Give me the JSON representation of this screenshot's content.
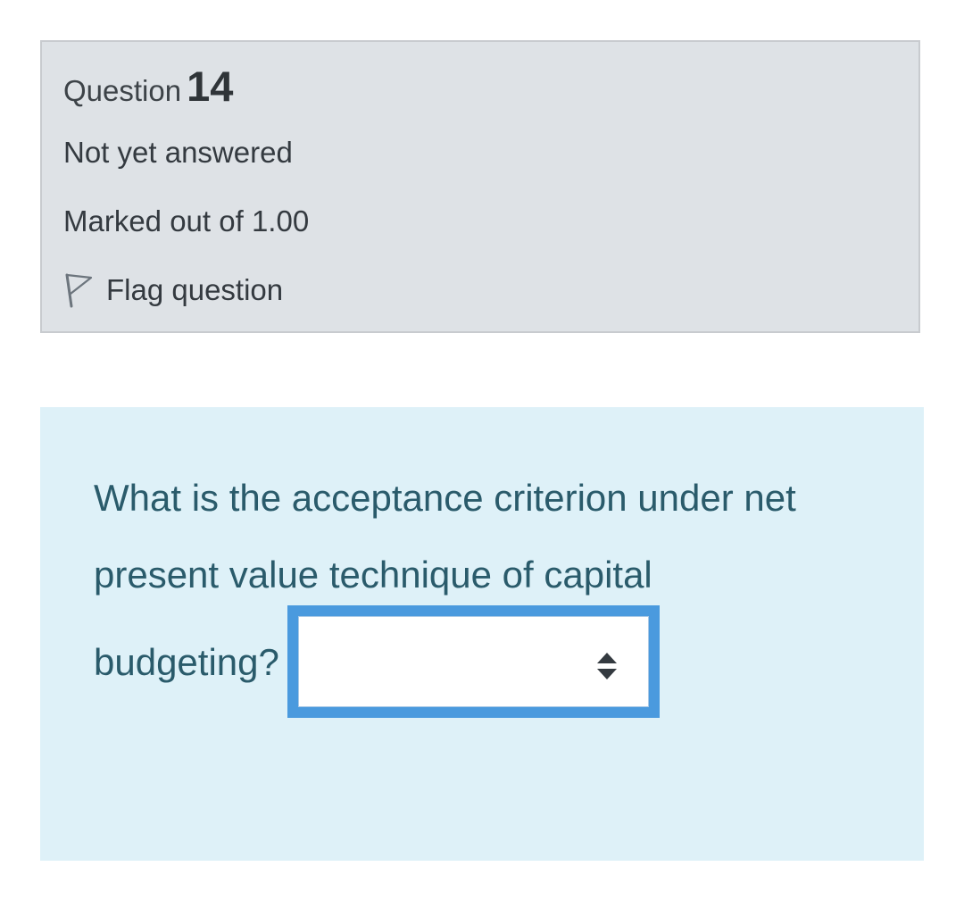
{
  "info": {
    "question_label": "Question",
    "question_number": "14",
    "state": "Not yet answered",
    "grade": "Marked out of 1.00",
    "flag_label": "Flag question",
    "flag_icon": "flag-outline-icon"
  },
  "question": {
    "line1": "What is the acceptance criterion under net",
    "line2": "present value technique of capital",
    "line3": "budgeting?",
    "selected_value": "",
    "select_icon": "sort-arrows-icon"
  },
  "colors": {
    "info_bg": "#dee2e6",
    "content_bg": "#def1f8",
    "question_text": "#2a5b6b",
    "select_focus_border": "#4a9ade"
  }
}
